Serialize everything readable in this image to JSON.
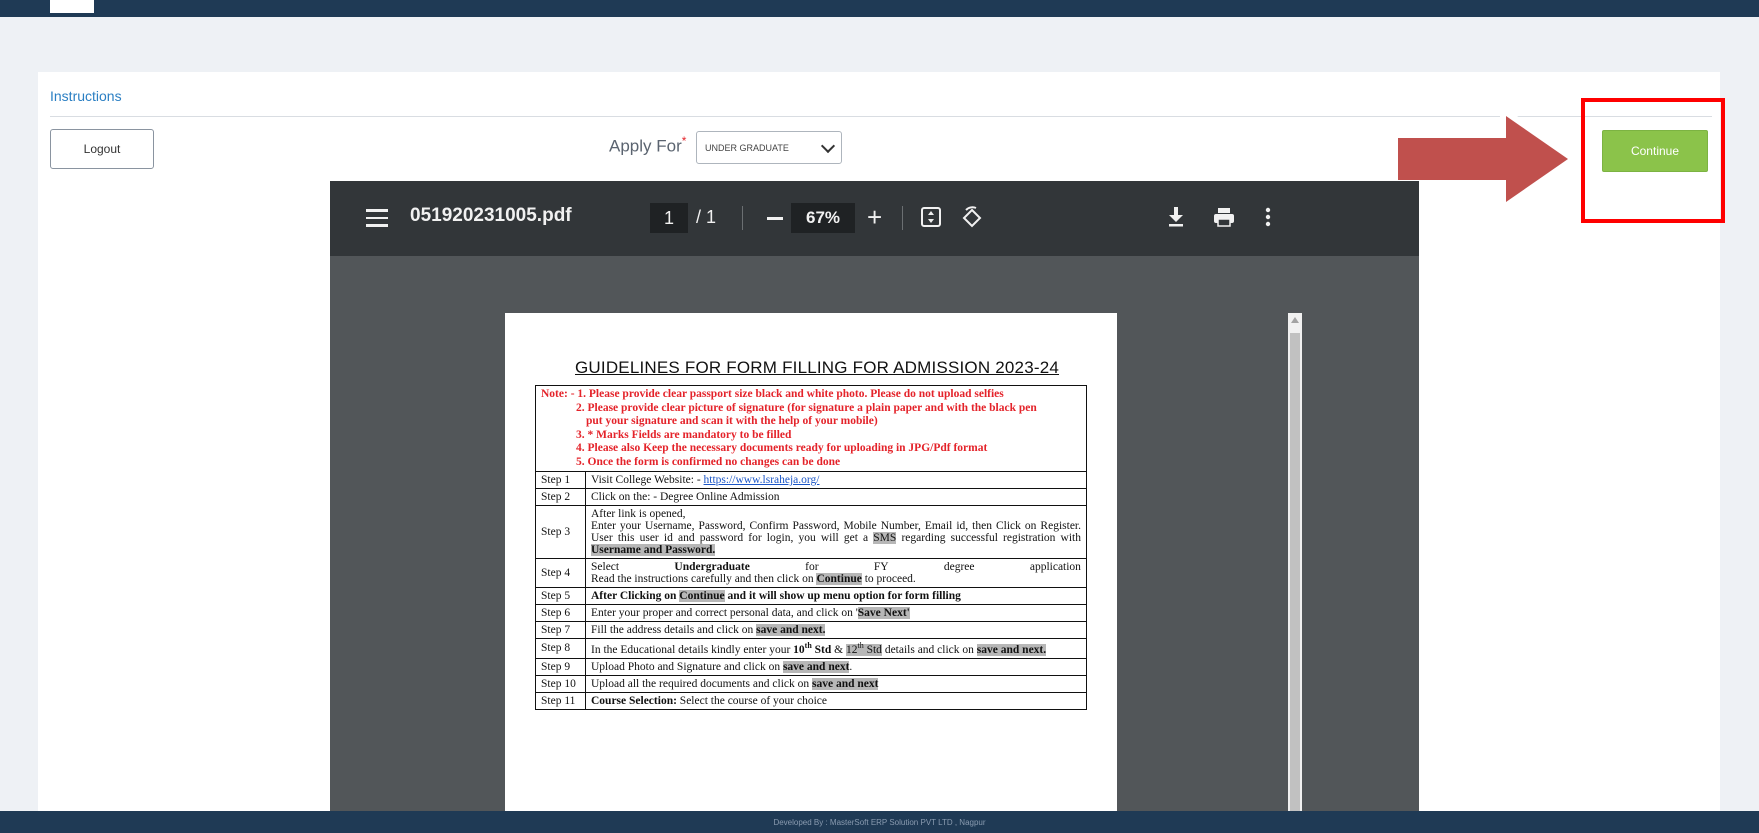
{
  "card": {
    "title": "Instructions"
  },
  "actions": {
    "logout_label": "Logout",
    "continue_label": "Continue"
  },
  "apply": {
    "label": "Apply For",
    "required_mark": "*",
    "selected": "UNDER GRADUATE"
  },
  "pdf_viewer": {
    "filename": "051920231005.pdf",
    "current_page": "1",
    "page_total": "/ 1",
    "zoom": "67%"
  },
  "document": {
    "title": "GUIDELINES FOR FORM FILLING FOR ADMISSION 2023-24",
    "notes": [
      "Note: - 1. Please provide clear passport size black and white photo. Please do not upload selfies",
      "2. Please provide clear picture of signature (for signature a plain paper and with the black pen",
      "put your signature and scan it with the help of your mobile)",
      "3. * Marks Fields are mandatory to be filled",
      "4. Please also Keep the necessary documents ready for uploading in JPG/Pdf format",
      "5. Once the form is confirmed no changes can be done"
    ],
    "steps": {
      "s1": {
        "label": "Step 1",
        "text": "Visit College Website: - ",
        "link": "https://www.lsraheja.org/"
      },
      "s2": {
        "label": "Step 2",
        "text": "Click on the: - Degree Online Admission"
      },
      "s3": {
        "label": "Step 3",
        "line1": "After link is opened,",
        "line2": "Enter your Username, Password, Confirm Password, Mobile Number, Email id, then Click on Register. User this user id and password for login, you will get a ",
        "sms": "SMS",
        "line3": " regarding successful registration with ",
        "bold": "Username and Password."
      },
      "s4": {
        "label": "Step 4",
        "select": "Select",
        "ug": "Undergraduate",
        "for": "for",
        "fy": "FY",
        "degree": "degree",
        "application": "application",
        "line2a": "Read the instructions carefully and then click on ",
        "continue": "Continue",
        "line2b": " to proceed."
      },
      "s5": {
        "label": "Step 5",
        "a": "After Clicking on ",
        "continue": "Continue",
        "b": " and it will show up menu option for form filling"
      },
      "s6": {
        "label": "Step 6",
        "a": "Enter your proper and correct personal data, and click on '",
        "save": "Save Next'"
      },
      "s7": {
        "label": "Step 7",
        "a": "Fill the address details and click on ",
        "save": "save and next."
      },
      "s8": {
        "label": "Step 8",
        "a": "In the Educational details kindly enter your ",
        "std10": "10",
        "th1": "th",
        "std10b": " Std",
        "amp": " & ",
        "std12": "12",
        "th2": "th",
        "std12b": " Std",
        "b": " details and click on ",
        "save": "save and next."
      },
      "s9": {
        "label": "Step 9",
        "a": "Upload Photo and Signature and click on ",
        "save": "save and next",
        "b": "."
      },
      "s10": {
        "label": "Step 10",
        "a": "Upload all the required documents and click on ",
        "save": "save and next"
      },
      "s11": {
        "label": "Step 11",
        "bold": "Course Selection:",
        "a": " Select the course of your choice"
      }
    }
  },
  "footer": {
    "text": "Developed By : MasterSoft ERP Solution PVT LTD , Nagpur"
  },
  "colors": {
    "header_bg": "#1f3a55",
    "continue_bg": "#8bc34a",
    "highlight": "#ff0000",
    "arrow": "#c0504d",
    "accent": "#2b7fc3"
  }
}
